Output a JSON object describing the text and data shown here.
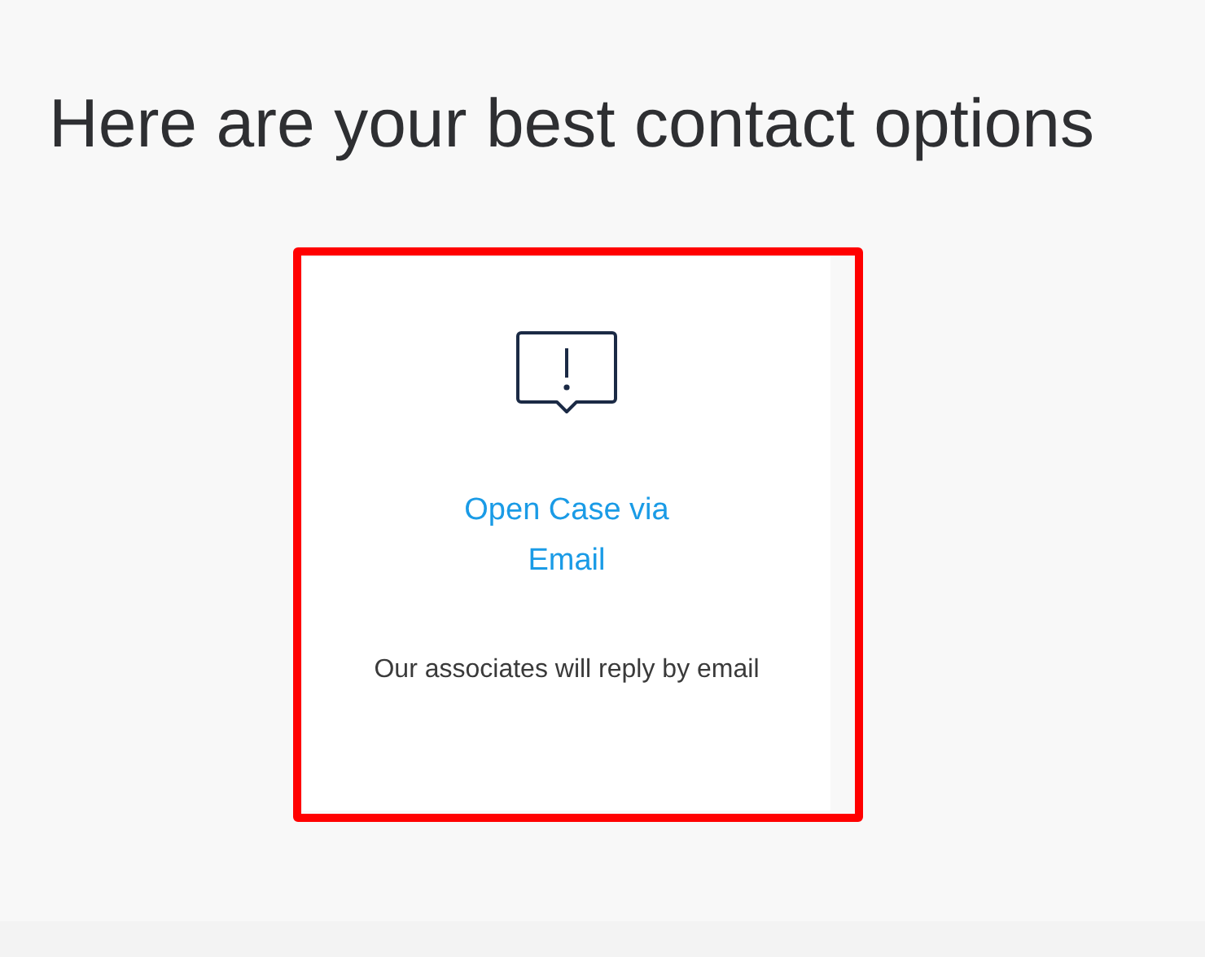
{
  "heading": "Here are your best contact options",
  "contact_options": [
    {
      "kind": "email",
      "title": "Open Case via Email",
      "description": "Our associates will reply by email",
      "highlighted": true
    }
  ]
}
